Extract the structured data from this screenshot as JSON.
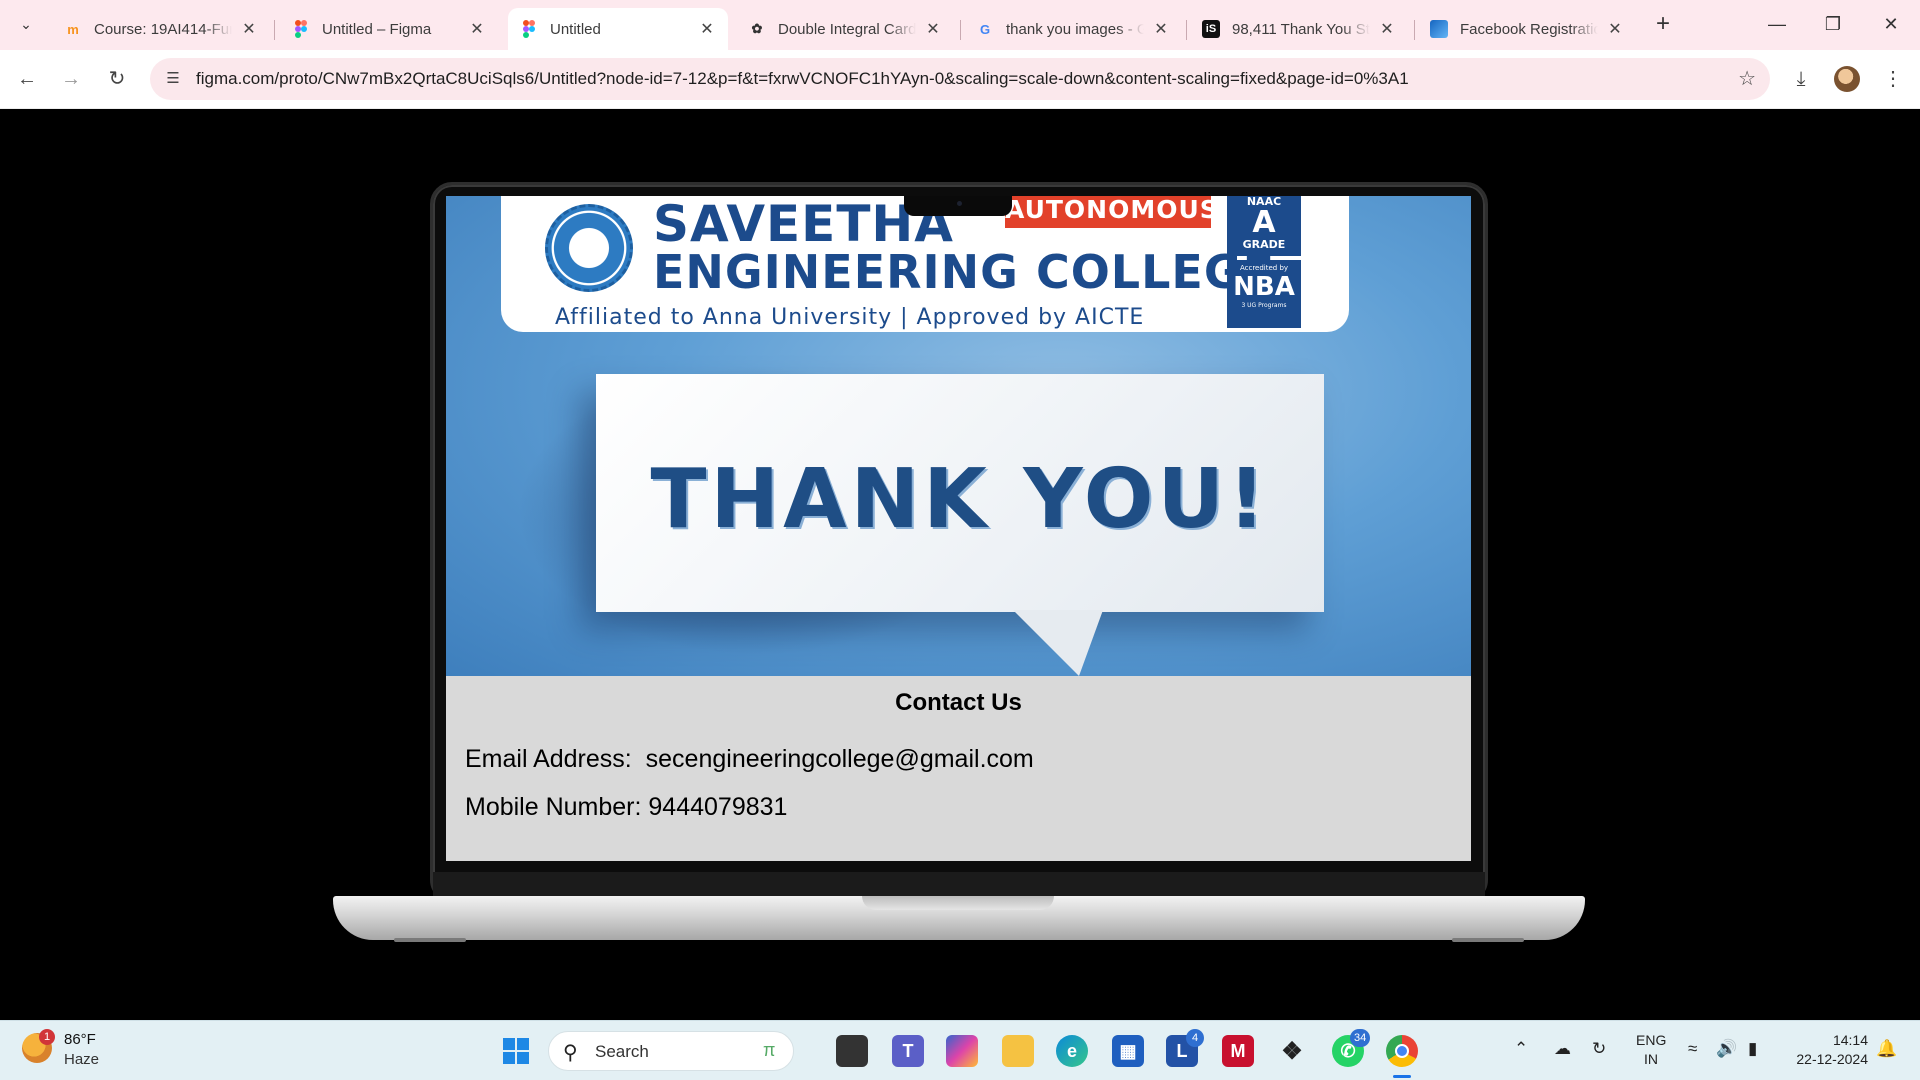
{
  "browser": {
    "tabs": [
      {
        "title": "Course: 19AI414-Fun",
        "favicon": "moodle-icon",
        "active": false
      },
      {
        "title": "Untitled – Figma",
        "favicon": "figma-icon",
        "active": false
      },
      {
        "title": "Untitled",
        "favicon": "figma-icon",
        "active": true
      },
      {
        "title": "Double Integral Card",
        "favicon": "openai-icon",
        "active": false
      },
      {
        "title": "thank you images - G",
        "favicon": "google-icon",
        "active": false
      },
      {
        "title": "98,411 Thank You St",
        "favicon": "istock-icon",
        "active": false
      },
      {
        "title": "Facebook Registratio",
        "favicon": "page-icon",
        "active": false
      }
    ],
    "url": "figma.com/proto/CNw7mBx2QrtaC8UciSqls6/Untitled?node-id=7-12&p=f&t=fxrwVCNOFC1hYAyn-0&scaling=scale-down&content-scaling=fixed&page-id=0%3A1"
  },
  "banner": {
    "college_line1": "SAVEETHA",
    "college_line2": "ENGINEERING COLLEGE",
    "autonomous": "AUTONOMOUS",
    "affiliation": "Affiliated to Anna University | Approved by AICTE",
    "naac_top": "NAAC",
    "naac_grade": "A",
    "naac_label": "GRADE",
    "nba_top": "Accredited by",
    "nba_name": "NBA",
    "nba_bottom": "3 UG Programs",
    "seal_text": "SAVEETHA",
    "thank_you": "THANK YOU!"
  },
  "contact": {
    "title": "Contact Us",
    "email_label": "Email Address:",
    "email": "secengineeringcollege@gmail.com",
    "mobile_label": "Mobile Number:",
    "mobile": "9444079831"
  },
  "taskbar": {
    "weather_temp": "86°F",
    "weather_condition": "Haze",
    "weather_badge": "1",
    "search_placeholder": "Search",
    "lens_badge": "4",
    "whatsapp_badge": "34",
    "lang_line1": "ENG",
    "lang_line2": "IN",
    "time": "14:14",
    "date": "22-12-2024"
  },
  "colors": {
    "tabstrip_bg": "#fde9ee",
    "accent_blue": "#1c4b8c",
    "autonomous_red": "#e2412a",
    "contact_bg": "#d9d9d9",
    "taskbar_bg": "#e3f0f4"
  }
}
